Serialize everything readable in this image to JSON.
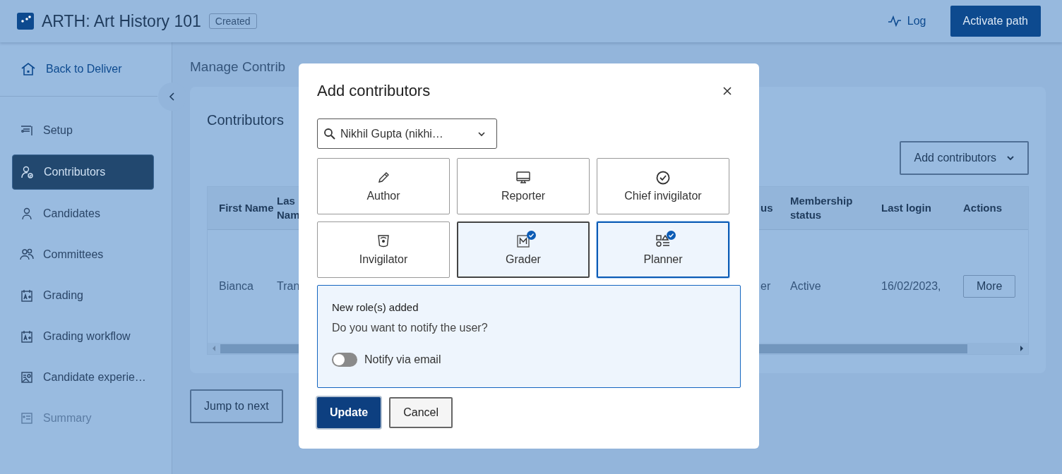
{
  "header": {
    "title": "ARTH: Art History 101",
    "badge": "Created",
    "log_link": "Log",
    "primary_button": "Activate path"
  },
  "sidebar": {
    "back_link": "Back to Deliver",
    "items": [
      {
        "label": "Setup",
        "selected": false,
        "disabled": false
      },
      {
        "label": "Contributors",
        "selected": true,
        "disabled": false
      },
      {
        "label": "Candidates",
        "selected": false,
        "disabled": false
      },
      {
        "label": "Committees",
        "selected": false,
        "disabled": false
      },
      {
        "label": "Grading",
        "selected": false,
        "disabled": false
      },
      {
        "label": "Grading workflow",
        "selected": false,
        "disabled": false
      },
      {
        "label": "Candidate experie…",
        "selected": false,
        "disabled": false
      },
      {
        "label": "Summary",
        "selected": false,
        "disabled": true
      }
    ]
  },
  "main": {
    "breadcrumb": "Manage Contrib",
    "card_title": "Contributors",
    "add_button": "Add contributors",
    "table": {
      "left_columns": [
        "First Name",
        "Las Nam"
      ],
      "right_columns": [
        "us",
        "Membership status",
        "Last login",
        "Actions"
      ],
      "rows": [
        {
          "left": [
            "Bianca",
            "Tran"
          ],
          "right": [
            "er",
            "Active",
            "16/02/2023,"
          ],
          "action": "More"
        }
      ]
    },
    "jump_button": "Jump to next"
  },
  "dialog": {
    "title": "Add contributors",
    "search": {
      "value": "Nikhil Gupta (nikhi…"
    },
    "roles": [
      {
        "label": "Author",
        "selected": false
      },
      {
        "label": "Reporter",
        "selected": false
      },
      {
        "label": "Chief invigilator",
        "selected": false
      },
      {
        "label": "Invigilator",
        "selected": false
      },
      {
        "label": "Grader",
        "selected": true
      },
      {
        "label": "Planner",
        "selected": true
      }
    ],
    "notice": {
      "heading": "New role(s) added",
      "question": "Do you want to notify the user?",
      "toggle": {
        "label": "Notify via email",
        "on": false
      }
    },
    "buttons": [
      "Update",
      "Cancel"
    ]
  }
}
